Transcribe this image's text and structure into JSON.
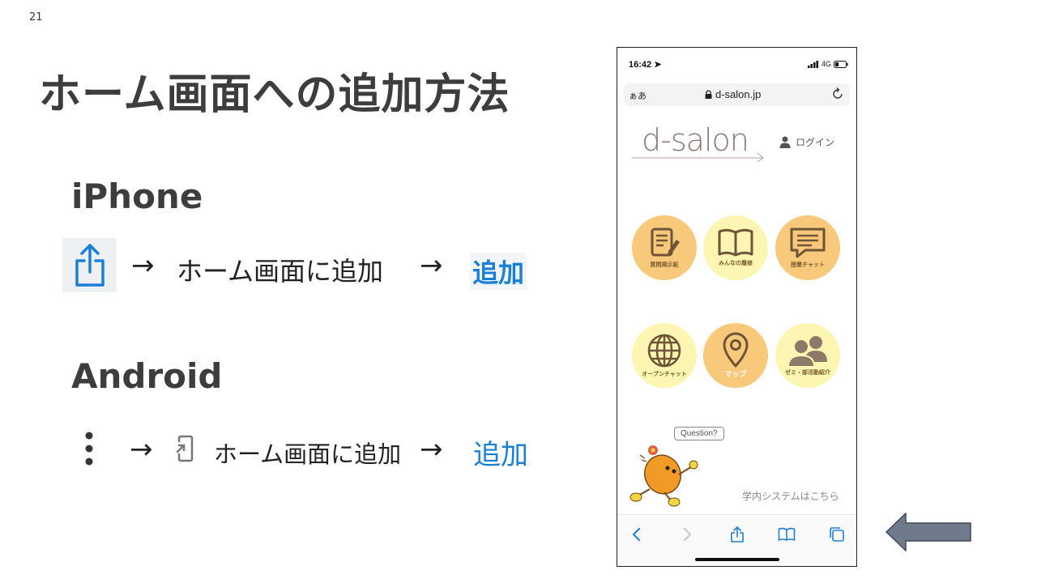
{
  "slide": {
    "page_number": "21",
    "title": "ホーム画面への追加方法"
  },
  "iphone": {
    "heading": "iPhone",
    "arrow": "→",
    "step": "ホーム画面に追加",
    "final": "追加"
  },
  "android": {
    "heading": "Android",
    "arrow": "→",
    "step": "ホーム画面に追加",
    "final": "追加"
  },
  "phone": {
    "status": {
      "time": "16:42",
      "network": "4G"
    },
    "url_bar": {
      "left_label": "ぁあ",
      "domain": "d-salon.jp"
    },
    "logo": "d-salon",
    "login_label": "ログイン",
    "menu": [
      {
        "label": "質問掲示板",
        "icon": "notepad-pencil-icon",
        "style": "orange"
      },
      {
        "label": "みんなの履修",
        "icon": "open-book-icon",
        "style": "yellow"
      },
      {
        "label": "授業チャット",
        "icon": "chat-bubble-icon",
        "style": "orange"
      },
      {
        "label": "オープンチャット",
        "icon": "globe-icon",
        "style": "yellow"
      },
      {
        "label": "マップ",
        "icon": "map-pin-icon",
        "style": "orange"
      },
      {
        "label": "ゼミ・部活動紹介",
        "icon": "group-icon",
        "style": "yellow"
      }
    ],
    "question_bubble": "Question?",
    "system_link": "学内システムはこちら"
  },
  "colors": {
    "accent_blue": "#1a7fd6",
    "circle_orange": "#f8c97a",
    "circle_yellow": "#fdf6b2",
    "side_arrow": "#6f7a8c"
  }
}
